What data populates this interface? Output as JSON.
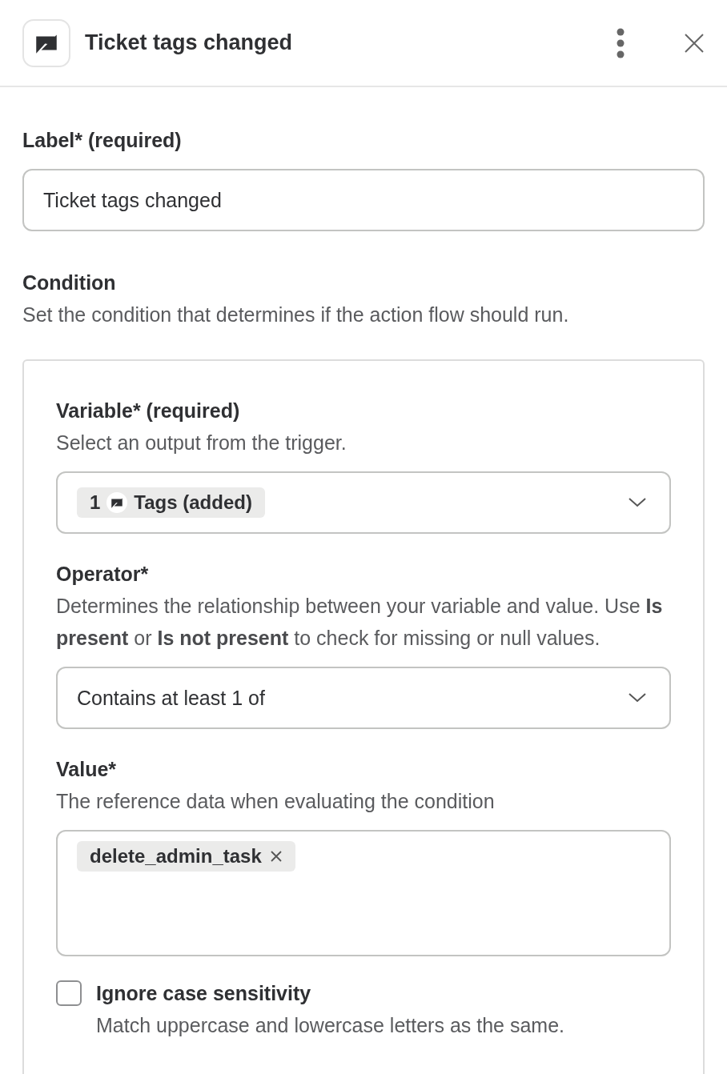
{
  "header": {
    "title": "Ticket tags changed"
  },
  "label_field": {
    "label": "Label* (required)",
    "value": "Ticket tags changed"
  },
  "condition": {
    "title": "Condition",
    "description": "Set the condition that determines if the action flow should run.",
    "variable": {
      "label": "Variable* (required)",
      "description": "Select an output from the trigger.",
      "chip_step": "1",
      "chip_text": "Tags (added)"
    },
    "operator": {
      "label": "Operator*",
      "description": "Determines the relationship between your variable and value. Use **Is present** or **Is not present** to check for missing or null values.",
      "value": "Contains at least 1 of"
    },
    "value": {
      "label": "Value*",
      "description": "The reference data when evaluating the condition",
      "tags": [
        "delete_admin_task"
      ]
    },
    "ignore_case": {
      "label": "Ignore case sensitivity",
      "description": "Match uppercase and lowercase letters as the same.",
      "checked": false
    }
  }
}
